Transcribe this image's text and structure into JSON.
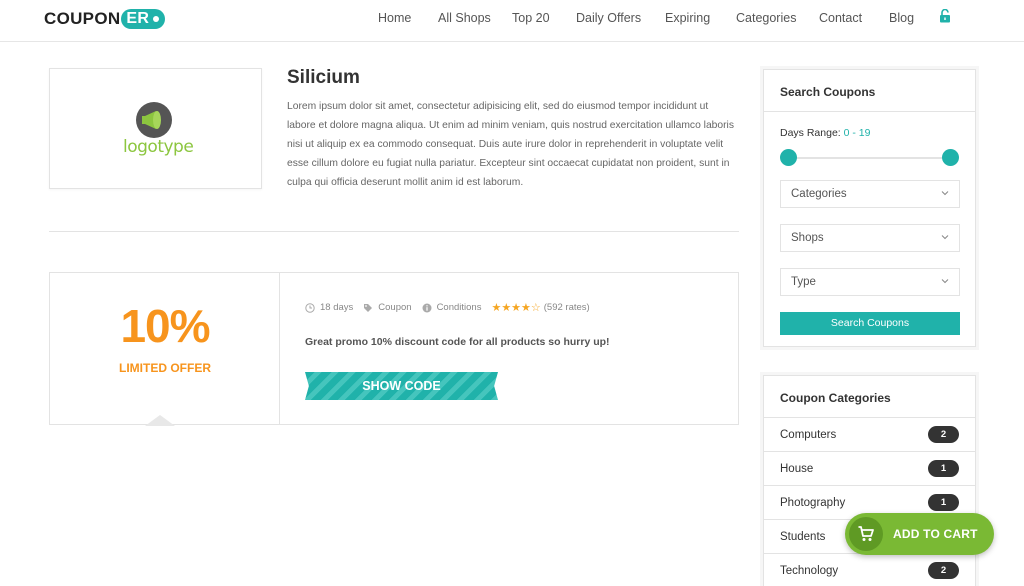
{
  "header": {
    "logo_main": "COUPON",
    "logo_accent": "ER",
    "nav": [
      "Home",
      "All Shops",
      "Top 20",
      "Daily Offers",
      "Expiring",
      "Categories",
      "Contact",
      "Blog"
    ]
  },
  "shop": {
    "logo_text": "logotype",
    "title": "Silicium",
    "description": "Lorem ipsum dolor sit amet, consectetur adipisicing elit, sed do eiusmod tempor incididunt ut labore et dolore magna aliqua. Ut enim ad minim veniam, quis nostrud exercitation ullamco laboris nisi ut aliquip ex ea commodo consequat. Duis aute irure dolor in reprehenderit in voluptate velit esse cillum dolore eu fugiat nulla pariatur. Excepteur sint occaecat cupidatat non proident, sunt in culpa qui officia deserunt mollit anim id est laborum."
  },
  "coupon": {
    "value": "10%",
    "subtitle": "LIMITED OFFER",
    "days": "18 days",
    "type": "Coupon",
    "conditions": "Conditions",
    "stars": "★★★★☆",
    "rating": 4,
    "rates": "(592 rates)",
    "promo_text": "Great promo 10% discount code for all products so hurry up!",
    "show_code_label": "SHOW CODE"
  },
  "search_widget": {
    "title": "Search Coupons",
    "days_label": "Days Range:",
    "days_range": "0 - 19",
    "range_min": 0,
    "range_max": 19,
    "selects": [
      "Categories",
      "Shops",
      "Type"
    ],
    "button_label": "Search Coupons"
  },
  "categories_widget": {
    "title": "Coupon Categories",
    "items": [
      {
        "label": "Computers",
        "count": "2"
      },
      {
        "label": "House",
        "count": "1"
      },
      {
        "label": "Photography",
        "count": "1"
      },
      {
        "label": "Students",
        "count": ""
      },
      {
        "label": "Technology",
        "count": "2"
      }
    ]
  },
  "cart": {
    "label": "ADD TO CART"
  },
  "colors": {
    "accent": "#20b2aa",
    "orange": "#f7941d",
    "green": "#7ab934"
  }
}
